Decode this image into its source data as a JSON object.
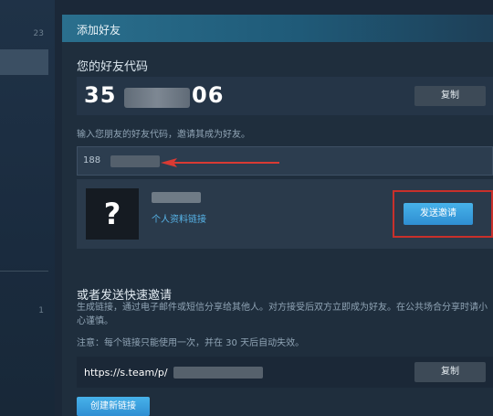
{
  "sidebar": {
    "count_top": "23",
    "count_bottom": "1"
  },
  "header": {
    "title": "添加好友"
  },
  "friend_code": {
    "section_title": "您的好友代码",
    "code_prefix": "35",
    "code_suffix": "06",
    "copy_label": "复制"
  },
  "add_by_code": {
    "hint": "输入您朋友的好友代码，邀请其成为好友。",
    "input_value": "188",
    "avatar_glyph": "?",
    "profile_link": "个人资料链接",
    "send_invite_label": "发送邀请"
  },
  "quick_invite": {
    "title": "或者发送快速邀请",
    "description": "生成链接，通过电子邮件或短信分享给其他人。对方接受后双方立即成为好友。在公共场合分享时请小心谨慎。",
    "note": "注意：每个链接只能使用一次，并在 30 天后自动失效。",
    "link_prefix": "https://s.team/p/",
    "copy_label": "复制",
    "create_label": "创建新链接"
  },
  "colors": {
    "background": "#1b2838",
    "header_accent": "#2a6f8d",
    "primary_button": "#47b2ea",
    "link": "#57b4e8",
    "highlight_red": "#c8302b"
  }
}
